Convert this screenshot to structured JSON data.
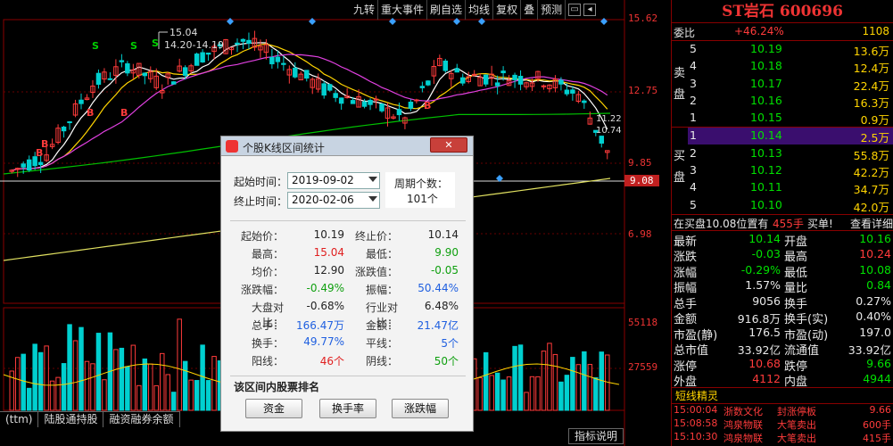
{
  "toolbar": {
    "items": [
      "九转",
      "重大事件",
      "刷自选",
      "均线",
      "复权",
      "叠",
      "预测"
    ]
  },
  "chart": {
    "price_axis": [
      "15.62",
      "12.75",
      "9.85",
      "9.08",
      "6.98"
    ],
    "volume_axis": [
      "55118",
      "27559"
    ],
    "peak_price": "15.04",
    "peak_range": "14.20-14.19",
    "right_annotations": [
      "11.22",
      "10.74"
    ],
    "buy_markers": [
      "B",
      "B",
      "B",
      "B",
      "B"
    ],
    "sell_markers": [
      "S",
      "S",
      "S"
    ]
  },
  "bottom_tabs": [
    "(ttm)",
    "陆股通持股",
    "融资融券余额"
  ],
  "help_button": "指标说明",
  "panel": {
    "title": "ST岩石 600696",
    "weibi_label": "委比",
    "weibi_value": "+46.24%",
    "weibi_qty": "1108",
    "sell_label": "卖盘",
    "buy_label": "买盘",
    "sell_orders": [
      {
        "level": "5",
        "price": "10.19",
        "qty": "13.6万"
      },
      {
        "level": "4",
        "price": "10.18",
        "qty": "12.4万"
      },
      {
        "level": "3",
        "price": "10.17",
        "qty": "22.4万"
      },
      {
        "level": "2",
        "price": "10.16",
        "qty": "16.3万"
      },
      {
        "level": "1",
        "price": "10.15",
        "qty": "0.9万"
      }
    ],
    "buy_orders": [
      {
        "level": "1",
        "price": "10.14",
        "qty": "2.5万"
      },
      {
        "level": "2",
        "price": "10.13",
        "qty": "55.8万"
      },
      {
        "level": "3",
        "price": "10.12",
        "qty": "42.2万"
      },
      {
        "level": "4",
        "price": "10.11",
        "qty": "34.7万"
      },
      {
        "level": "5",
        "price": "10.10",
        "qty": "42.0万"
      }
    ],
    "inbuy_text": "在买盘10.08位置有",
    "inbuy_qty": "455手",
    "inbuy_tag": "买单!",
    "inbuy_link": "查看详细",
    "stats": [
      {
        "k1": "最新",
        "v1": "10.14",
        "c1": "green",
        "k2": "开盘",
        "v2": "10.16",
        "c2": "green"
      },
      {
        "k1": "涨跌",
        "v1": "-0.03",
        "c1": "green",
        "k2": "最高",
        "v2": "10.24",
        "c2": "red"
      },
      {
        "k1": "涨幅",
        "v1": "-0.29%",
        "c1": "green",
        "k2": "最低",
        "v2": "10.08",
        "c2": "green"
      },
      {
        "k1": "振幅",
        "v1": "1.57%",
        "c1": "white",
        "k2": "量比",
        "v2": "0.84",
        "c2": "green"
      },
      {
        "k1": "总手",
        "v1": "9056",
        "c1": "white",
        "k2": "换手",
        "v2": "0.27%",
        "c2": "white"
      },
      {
        "k1": "金额",
        "v1": "916.8万",
        "c1": "white",
        "k2": "换手(实)",
        "v2": "0.40%",
        "c2": "white"
      },
      {
        "k1": "市盈(静)",
        "v1": "176.5",
        "c1": "white",
        "k2": "市盈(动)",
        "v2": "197.0",
        "c2": "white"
      },
      {
        "k1": "总市值",
        "v1": "33.92亿",
        "c1": "white",
        "k2": "流通值",
        "v2": "33.92亿",
        "c2": "white"
      },
      {
        "k1": "涨停",
        "v1": "10.68",
        "c1": "red",
        "k2": "跌停",
        "v2": "9.66",
        "c2": "green"
      },
      {
        "k1": "外盘",
        "v1": "4112",
        "c1": "red",
        "k2": "内盘",
        "v2": "4944",
        "c2": "green"
      }
    ],
    "short_title": "短线精灵",
    "news": [
      {
        "time": "15:00:04",
        "name": "浙数文化",
        "event": "封涨停板",
        "val": "9.66"
      },
      {
        "time": "15:08:58",
        "name": "鸿泉物联",
        "event": "大笔卖出",
        "val": "600手"
      },
      {
        "time": "15:10:30",
        "name": "鸿泉物联",
        "event": "大笔卖出",
        "val": "415手"
      }
    ]
  },
  "dialog": {
    "title": "个股K线区间统计",
    "close_label": "关闭",
    "start_label": "起始时间：",
    "start_value": "2019-09-02",
    "end_label": "终止时间：",
    "end_value": "2020-02-06",
    "period_label": "周期个数：",
    "period_value": "101个",
    "stats_left": [
      {
        "k": "起始价：",
        "v": "10.19",
        "c": "#222"
      },
      {
        "k": "最高：",
        "v": "15.04",
        "c": "#e02020"
      },
      {
        "k": "均价：",
        "v": "12.90",
        "c": "#222"
      },
      {
        "k": "涨跌幅：",
        "v": "-0.49%",
        "c": "#10a010"
      },
      {
        "k": "大盘对比：",
        "v": "-0.68%",
        "c": "#222"
      },
      {
        "k": "总手：",
        "v": "166.47万",
        "c": "#2060e0"
      },
      {
        "k": "换手：",
        "v": "49.77%",
        "c": "#2060e0"
      },
      {
        "k": "阳线：",
        "v": "46个",
        "c": "#e02020"
      }
    ],
    "stats_right": [
      {
        "k": "终止价：",
        "v": "10.14",
        "c": "#222"
      },
      {
        "k": "最低：",
        "v": "9.90",
        "c": "#10a010"
      },
      {
        "k": "涨跌值：",
        "v": "-0.05",
        "c": "#10a010"
      },
      {
        "k": "振幅：",
        "v": "50.44%",
        "c": "#2060e0"
      },
      {
        "k": "行业对比：",
        "v": "6.48%",
        "c": "#222"
      },
      {
        "k": "金额：",
        "v": "21.47亿",
        "c": "#2060e0"
      },
      {
        "k": "平线：",
        "v": "5个",
        "c": "#2060e0"
      },
      {
        "k": "阴线：",
        "v": "50个",
        "c": "#10a010"
      }
    ],
    "ranking_label": "该区间内股票排名",
    "buttons": [
      "资金",
      "换手率",
      "涨跌幅"
    ]
  },
  "colors": {
    "up": "#ff3b3b",
    "down": "#00d0d0",
    "ma5": "#ffffff",
    "ma10": "#ffd400",
    "ma20": "#e040e0",
    "ma60": "#00c000",
    "ma120": "#e0e060"
  }
}
